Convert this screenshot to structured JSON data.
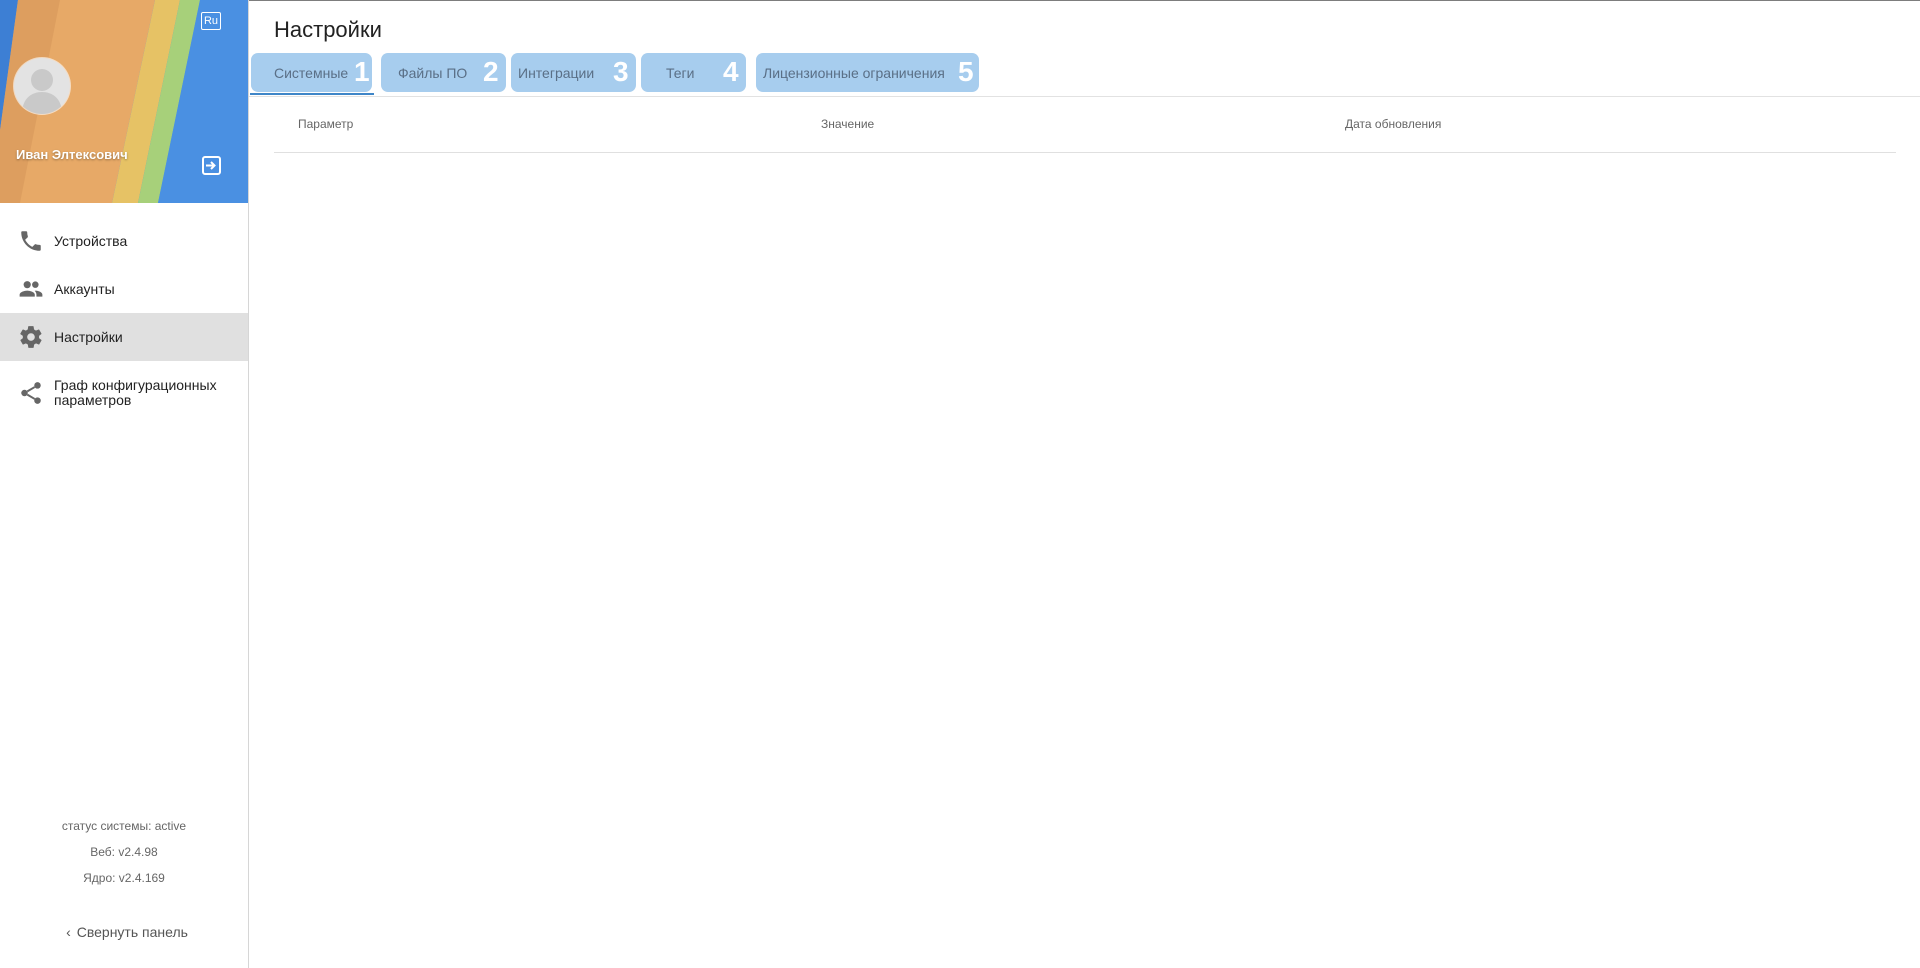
{
  "sidebar": {
    "user": {
      "name": "Иван Элтексович"
    },
    "lang_label": "Ru",
    "items": [
      {
        "label": "Устройства",
        "icon": "phone-icon",
        "active": false
      },
      {
        "label": "Аккаунты",
        "icon": "people-icon",
        "active": false
      },
      {
        "label": "Настройки",
        "icon": "gear-icon",
        "active": true
      },
      {
        "label": "Граф конфигурационных параметров",
        "icon": "share-icon",
        "active": false
      }
    ],
    "status": {
      "system": "статус системы:  active",
      "web": "Веб: v2.4.98",
      "core": "Ядро: v2.4.169"
    },
    "collapse_label": "Свернуть панель"
  },
  "main": {
    "title": "Настройки",
    "tabs": [
      {
        "label": "Системные",
        "badge": "1",
        "active": true
      },
      {
        "label": "Файлы ПО",
        "badge": "2",
        "active": false
      },
      {
        "label": "Интеграции",
        "badge": "3",
        "active": false
      },
      {
        "label": "Теги",
        "badge": "4",
        "active": false
      },
      {
        "label": "Лицензионные ограничения",
        "badge": "5",
        "active": false
      }
    ],
    "table": {
      "columns": [
        "Параметр",
        "Значение",
        "Дата обновления"
      ]
    }
  },
  "colors": {
    "tab_bg": "#a7cdee",
    "active_underline": "#3f86c8",
    "active_nav_bg": "#e0e0e0"
  }
}
